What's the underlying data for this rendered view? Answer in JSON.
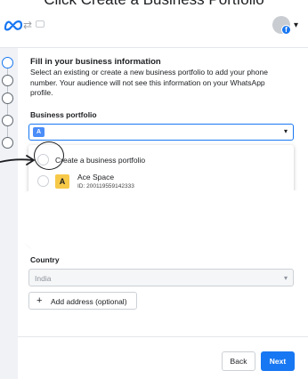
{
  "caption": "Click Create a Business Portfolio",
  "header": {
    "logo_icon": "meta-logo-icon",
    "swap_icon": "swap-arrows-icon",
    "account_badge_letter": "f",
    "caret": "▾",
    "brand_color": "#1877f2"
  },
  "stepper": {
    "steps": 5,
    "active_step": 1
  },
  "form": {
    "title": "Fill in your business information",
    "description": "Select an existing or create a new business portfolio to add your phone number. Your audience will not see this information on your WhatsApp profile.",
    "portfolio_label": "Business portfolio",
    "portfolio_selected_initial": "A",
    "dropdown": {
      "create_option": "Create a business portfolio",
      "portfolio_name": "Ace Space",
      "portfolio_initial": "A",
      "portfolio_id": "ID: 200119559142333"
    },
    "country_label": "Country",
    "country_value": "India",
    "add_address_label": "Add address (optional)"
  },
  "footer": {
    "back_label": "Back",
    "next_label": "Next"
  }
}
